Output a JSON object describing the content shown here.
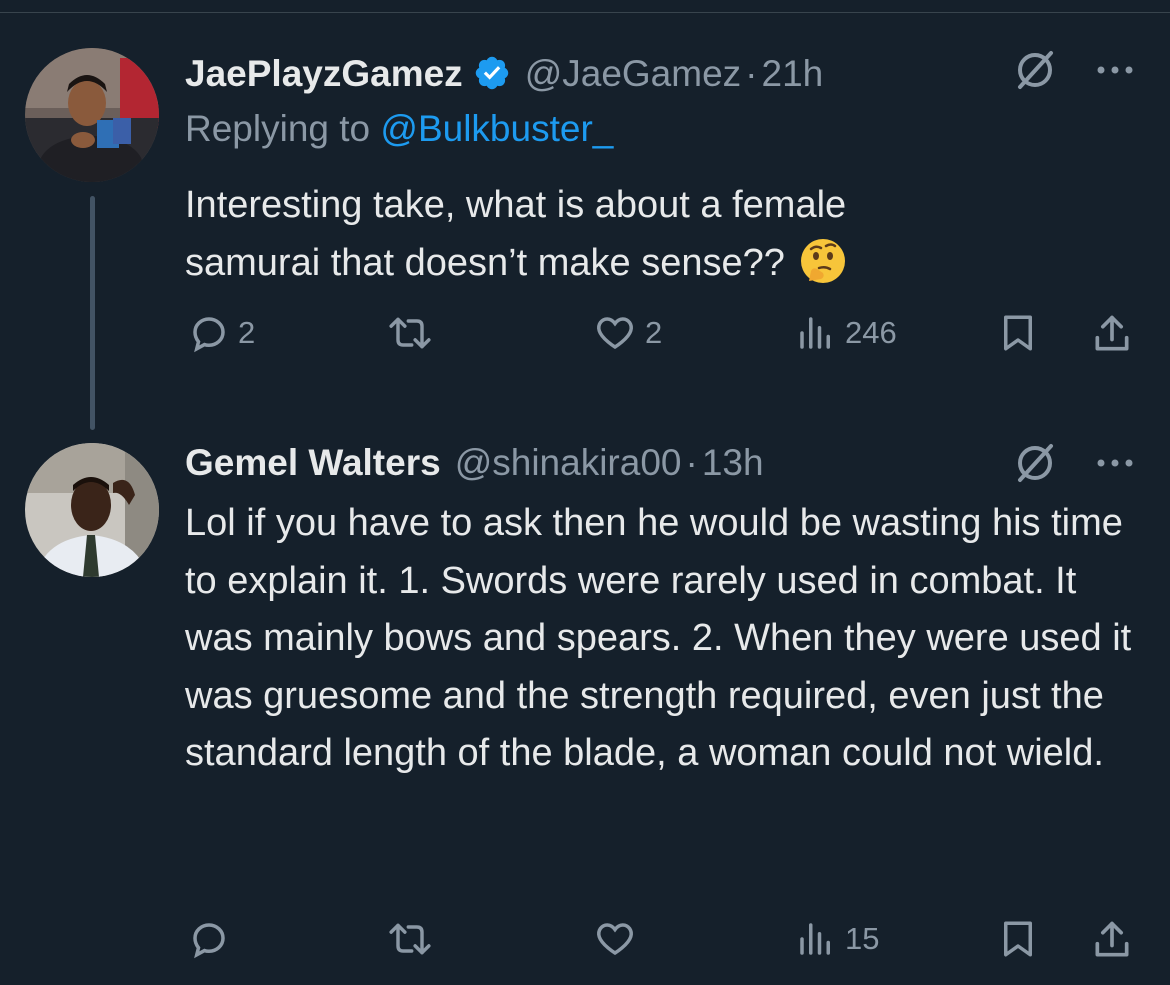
{
  "tweets": [
    {
      "name": "JaePlayzGamez",
      "verified": true,
      "handle": "@JaeGamez",
      "time": "21h",
      "replying_prefix": "Replying to ",
      "replying_to": "@Bulkbuster_",
      "text": "Interesting take, what is about a female samurai that doesn’t make sense??",
      "emoji": "thinking-face",
      "replies": "2",
      "retweets": "",
      "likes": "2",
      "views": "246"
    },
    {
      "name": "Gemel Walters",
      "verified": false,
      "handle": "@shinakira00",
      "time": "13h",
      "text": "Lol if you have to ask then he would be wasting his time to explain it. 1. Swords were rarely used in combat. It was mainly bows and spears. 2. When they were used it was gruesome and the strength required, even just the standard length of the blade, a woman could not wield.",
      "replies": "",
      "retweets": "",
      "likes": "",
      "views": "15"
    }
  ],
  "separator": "·",
  "colors": {
    "background": "#15202b",
    "text": "#e7e9ea",
    "secondary": "#8b98a5",
    "link": "#1d9bf0",
    "verified": "#1d9bf0"
  }
}
